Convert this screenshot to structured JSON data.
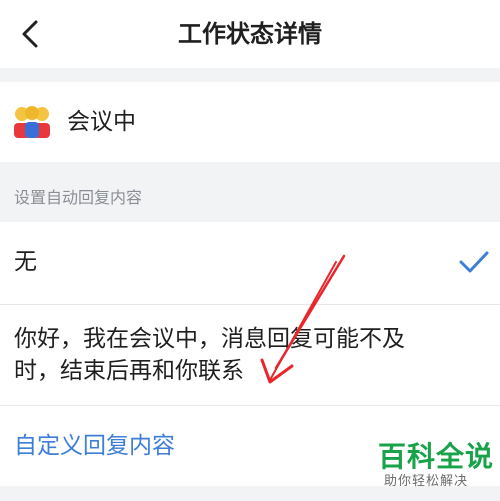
{
  "header": {
    "title": "工作状态详情",
    "back_icon": "chevron-left-icon"
  },
  "status": {
    "icon": "meeting-people-emoji-icon",
    "label": "会议中"
  },
  "auto_reply": {
    "section_label": "设置自动回复内容",
    "options": [
      {
        "label": "无",
        "selected": true
      },
      {
        "label": "你好，我在会议中，消息回复可能不及时，结束后再和你联系",
        "selected": false
      }
    ],
    "custom_label": "自定义回复内容"
  },
  "watermark": {
    "brand": "百科全说",
    "sub": "助你轻松解决"
  },
  "colors": {
    "accent": "#3f7ed6",
    "annotation": "#e8262b",
    "watermark": "#18a34a"
  }
}
